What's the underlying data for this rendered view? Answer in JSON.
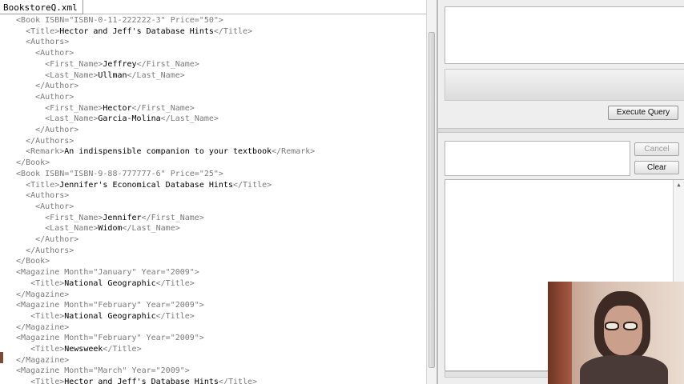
{
  "editor": {
    "tab_title": "BookstoreQ.xml",
    "lines": [
      {
        "indent": 2,
        "pre": "<Book ISBN=\"ISBN-0-11-222222-3\" Price=\"50\">",
        "value": "",
        "post": ""
      },
      {
        "indent": 4,
        "pre": "<Title>",
        "value": "Hector and Jeff's Database Hints",
        "post": "</Title>"
      },
      {
        "indent": 4,
        "pre": "<Authors>",
        "value": "",
        "post": ""
      },
      {
        "indent": 6,
        "pre": "<Author>",
        "value": "",
        "post": ""
      },
      {
        "indent": 8,
        "pre": "<First_Name>",
        "value": "Jeffrey",
        "post": "</First_Name>"
      },
      {
        "indent": 8,
        "pre": "<Last_Name>",
        "value": "Ullman",
        "post": "</Last_Name>"
      },
      {
        "indent": 6,
        "pre": "</Author>",
        "value": "",
        "post": ""
      },
      {
        "indent": 6,
        "pre": "<Author>",
        "value": "",
        "post": ""
      },
      {
        "indent": 8,
        "pre": "<First_Name>",
        "value": "Hector",
        "post": "</First_Name>"
      },
      {
        "indent": 8,
        "pre": "<Last_Name>",
        "value": "Garcia-Molina",
        "post": "</Last_Name>"
      },
      {
        "indent": 6,
        "pre": "</Author>",
        "value": "",
        "post": ""
      },
      {
        "indent": 4,
        "pre": "</Authors>",
        "value": "",
        "post": ""
      },
      {
        "indent": 4,
        "pre": "<Remark>",
        "value": "An indispensible companion to your textbook",
        "post": "</Remark>"
      },
      {
        "indent": 2,
        "pre": "</Book>",
        "value": "",
        "post": ""
      },
      {
        "indent": 2,
        "pre": "<Book ISBN=\"ISBN-9-88-777777-6\" Price=\"25\">",
        "value": "",
        "post": ""
      },
      {
        "indent": 4,
        "pre": "<Title>",
        "value": "Jennifer's Economical Database Hints",
        "post": "</Title>"
      },
      {
        "indent": 4,
        "pre": "<Authors>",
        "value": "",
        "post": ""
      },
      {
        "indent": 6,
        "pre": "<Author>",
        "value": "",
        "post": ""
      },
      {
        "indent": 8,
        "pre": "<First_Name>",
        "value": "Jennifer",
        "post": "</First_Name>"
      },
      {
        "indent": 8,
        "pre": "<Last_Name>",
        "value": "Widom",
        "post": "</Last_Name>"
      },
      {
        "indent": 6,
        "pre": "</Author>",
        "value": "",
        "post": ""
      },
      {
        "indent": 4,
        "pre": "</Authors>",
        "value": "",
        "post": ""
      },
      {
        "indent": 2,
        "pre": "</Book>",
        "value": "",
        "post": ""
      },
      {
        "indent": 2,
        "pre": "<Magazine Month=\"January\" Year=\"2009\">",
        "value": "",
        "post": ""
      },
      {
        "indent": 5,
        "pre": "<Title>",
        "value": "National Geographic",
        "post": "</Title>"
      },
      {
        "indent": 2,
        "pre": "</Magazine>",
        "value": "",
        "post": ""
      },
      {
        "indent": 2,
        "pre": "<Magazine Month=\"February\" Year=\"2009\">",
        "value": "",
        "post": ""
      },
      {
        "indent": 5,
        "pre": "<Title>",
        "value": "National Geographic",
        "post": "</Title>"
      },
      {
        "indent": 2,
        "pre": "</Magazine>",
        "value": "",
        "post": ""
      },
      {
        "indent": 2,
        "pre": "<Magazine Month=\"February\" Year=\"2009\">",
        "value": "",
        "post": ""
      },
      {
        "indent": 5,
        "pre": "<Title>",
        "value": "Newsweek",
        "post": "</Title>"
      },
      {
        "indent": 2,
        "pre": "</Magazine>",
        "value": "",
        "post": ""
      },
      {
        "indent": 2,
        "pre": "<Magazine Month=\"March\" Year=\"2009\">",
        "value": "",
        "post": ""
      },
      {
        "indent": 5,
        "pre": "<Title>",
        "value": "Hector and Jeff's Database Hints",
        "post": "</Title>"
      }
    ]
  },
  "query": {
    "execute_label": "Execute Query",
    "cancel_label": "Cancel",
    "clear_label": "Clear"
  },
  "colors": {
    "tag": "#7a7a7a",
    "text": "#000000",
    "pane_bg": "#eeeeee"
  }
}
